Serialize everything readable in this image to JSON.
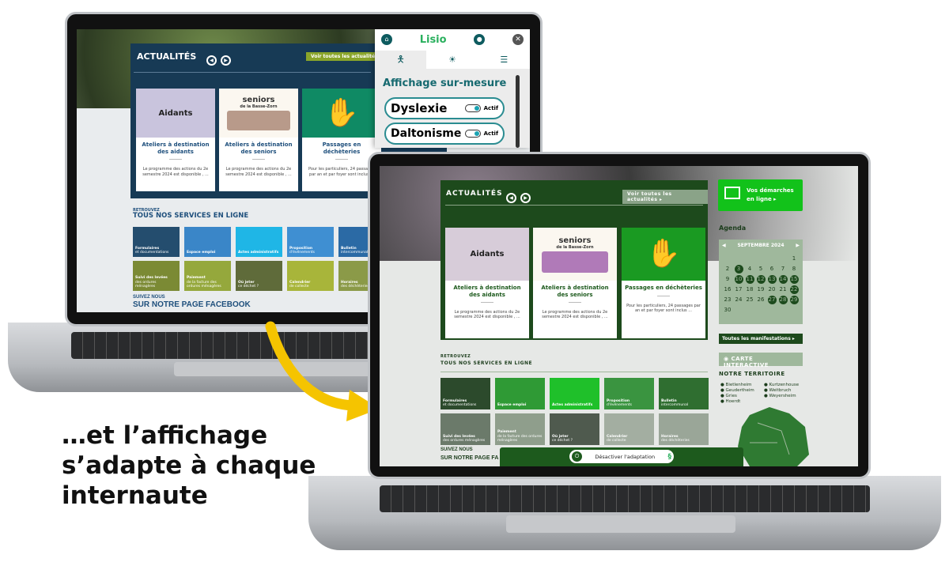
{
  "caption": {
    "lines": [
      "…et l’affichage",
      "s’adapte à chaque",
      "internaute"
    ]
  },
  "back": {
    "news_title": "ACTUALITÉS",
    "see_all": "Voir toutes les actualités ▸",
    "cards": [
      {
        "image_text": "Aidants",
        "image_sub": "",
        "title": "Ateliers à destination des aidants",
        "desc": "Le programme des actions du 2e semestre 2024 est disponible , ..."
      },
      {
        "image_text": "seniors",
        "image_sub": "de la Basse-Zorn",
        "title": "Ateliers à destination des seniors",
        "desc": "Le programme des actions du 2e semestre 2024 est disponible , ..."
      },
      {
        "image_text": "",
        "image_sub": "",
        "title": "Passages en déchèteries",
        "desc": "Pour les particuliers, 24 passages par an et par foyer sont inclus ..."
      }
    ],
    "services_kicker": "RETROUVEZ",
    "services_title": "TOUS NOS SERVICES EN LIGNE",
    "tiles": [
      {
        "b": "Formulaires",
        "s": "et documentations",
        "c": "#244d6e"
      },
      {
        "b": "Espace emploi",
        "s": "",
        "c": "#3a86c8"
      },
      {
        "b": "Actes administratifs",
        "s": "",
        "c": "#1fb6e6"
      },
      {
        "b": "Proposition",
        "s": "d'événements",
        "c": "#3f8fd2"
      },
      {
        "b": "Bulletin",
        "s": "intercommunal",
        "c": "#2b6aa5"
      },
      {
        "b": "Suivi des levées",
        "s": "des ordures ménagères",
        "c": "#7b8a34"
      },
      {
        "b": "Paiement",
        "s": "de la facture des ordures ménagères",
        "c": "#95a83c"
      },
      {
        "b": "Où jeter",
        "s": "ce déchet ?",
        "c": "#5f6b3a"
      },
      {
        "b": "Calendrier",
        "s": "de collecte",
        "c": "#a8b53a"
      },
      {
        "b": "Horaires",
        "s": "des déchèteries",
        "c": "#8b9a48"
      }
    ],
    "social_kicker": "SUIVEZ NOUS",
    "social_title": "SUR NOTRE PAGE FACEBOOK"
  },
  "lisio": {
    "brand": "Lisio",
    "section_title": "Affichage sur-mesure",
    "options": [
      {
        "label": "Dyslexie",
        "state": "Actif",
        "on": true
      },
      {
        "label": "Daltonisme",
        "state": "Actif",
        "on": true
      }
    ],
    "icons": [
      "home-icon",
      "user-icon",
      "close-icon",
      "accessibility-icon",
      "contrast-icon",
      "settings-sliders-icon"
    ]
  },
  "front": {
    "news_title": "ACTUALITÉS",
    "see_all": "Voir toutes les actualités ▸",
    "cards": [
      {
        "image_text": "Aidants",
        "image_sub": "",
        "title": "Ateliers à destination des aidants",
        "desc": "Le programme des actions du 2e semestre 2024 est disponible , ..."
      },
      {
        "image_text": "seniors",
        "image_sub": "de la Basse-Zorn",
        "title": "Ateliers à destination des seniors",
        "desc": "Le programme des actions du 2e semestre 2024 est disponible , ..."
      },
      {
        "image_text": "",
        "image_sub": "",
        "title": "Passages en déchèteries",
        "desc": "Pour les particuliers, 24 passages par an et par foyer sont inclus ..."
      }
    ],
    "demarches": "Vos démarches en ligne ▸",
    "agenda_title": "Agenda",
    "month": "SEPTEMBRE 2024",
    "calendar": {
      "offset": 6,
      "days": 30,
      "event_days": [
        3,
        10,
        11,
        12,
        13,
        14,
        15,
        22,
        27,
        28,
        29
      ]
    },
    "all_events": "Toutes les manifestations ▸",
    "map_button": "CARTE INTERACTIVE",
    "territory_title": "NOTRE TERRITOIRE",
    "towns": [
      "Bietlenheim",
      "Geudertheim",
      "Gries",
      "Hoerdt",
      "Kurtzenhouse",
      "Weitbruch",
      "Weyersheim"
    ],
    "services_kicker": "RETROUVEZ",
    "services_title": "TOUS NOS SERVICES EN LIGNE",
    "tiles": [
      {
        "b": "Formulaires",
        "s": "et documentations",
        "c": "#2c4a2c"
      },
      {
        "b": "Espace emploi",
        "s": "",
        "c": "#2f9a35"
      },
      {
        "b": "Actes administratifs",
        "s": "",
        "c": "#1fc02a"
      },
      {
        "b": "Proposition",
        "s": "d'événements",
        "c": "#3a9440"
      },
      {
        "b": "Bulletin",
        "s": "intercommunal",
        "c": "#2f6e30"
      },
      {
        "b": "Suivi des levées",
        "s": "des ordures ménagères",
        "c": "#6b7a6a"
      },
      {
        "b": "Paiement",
        "s": "de la facture des ordures ménagères",
        "c": "#8f9e8c"
      },
      {
        "b": "Où jeter",
        "s": "ce déchet ?",
        "c": "#4f5a4e"
      },
      {
        "b": "Calendrier",
        "s": "de collecte",
        "c": "#a3aea1"
      },
      {
        "b": "Horaires",
        "s": "des déchèteries",
        "c": "#9aa698"
      }
    ],
    "social_kicker": "SUIVEZ NOUS",
    "social_title": "SUR NOTRE PAGE FA",
    "disable_button": "Désactiver l'adaptation"
  },
  "colors": {
    "navy": "#173a55",
    "lisio_teal": "#2a8c91",
    "dark_green": "#1d4a1c",
    "bright_green": "#12c21a",
    "arrow_yellow": "#f5c400"
  }
}
